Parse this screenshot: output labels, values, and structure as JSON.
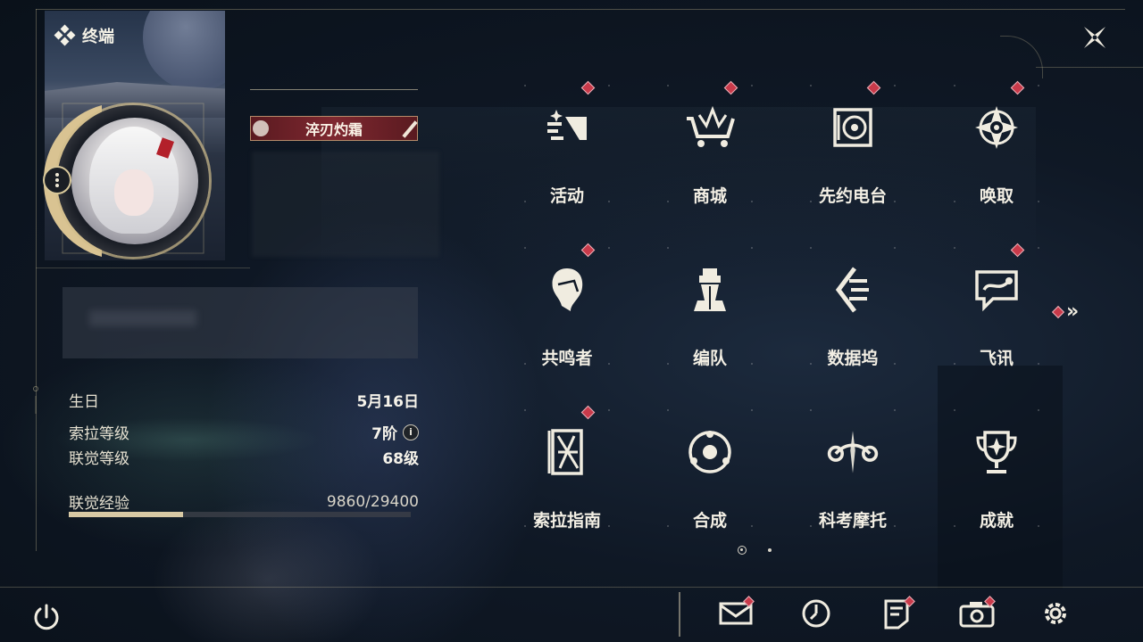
{
  "header": {
    "terminal_label": "终端"
  },
  "profile": {
    "title_badge": "淬刃灼霜",
    "stats": [
      {
        "label": "生日",
        "value": "5月16日"
      },
      {
        "label": "索拉等级",
        "value": "7阶"
      },
      {
        "label": "联觉等级",
        "value": "68级"
      }
    ],
    "experience": {
      "label": "联觉经验",
      "value": "9860/29400",
      "current": 9860,
      "max": 29400
    }
  },
  "menu": {
    "items": [
      {
        "label": "活动",
        "icon": "activity-icon",
        "badge": true
      },
      {
        "label": "商城",
        "icon": "shop-cart-icon",
        "badge": true
      },
      {
        "label": "先约电台",
        "icon": "radio-icon",
        "badge": true
      },
      {
        "label": "唤取",
        "icon": "summon-compass-icon",
        "badge": true
      },
      {
        "label": "共鸣者",
        "icon": "resonator-icon",
        "badge": true
      },
      {
        "label": "编队",
        "icon": "team-chess-icon",
        "badge": false
      },
      {
        "label": "数据坞",
        "icon": "data-bank-icon",
        "badge": false
      },
      {
        "label": "飞讯",
        "icon": "chat-icon",
        "badge": true
      },
      {
        "label": "索拉指南",
        "icon": "guidebook-icon",
        "badge": true
      },
      {
        "label": "合成",
        "icon": "synthesis-icon",
        "badge": false
      },
      {
        "label": "科考摩托",
        "icon": "motorcycle-icon",
        "badge": false
      },
      {
        "label": "成就",
        "icon": "trophy-icon",
        "badge": false
      }
    ],
    "pager": {
      "current": 1,
      "total": 2
    }
  },
  "bottom_bar": {
    "buttons": [
      {
        "icon": "mail-icon",
        "badge": true
      },
      {
        "icon": "clock-icon",
        "badge": false
      },
      {
        "icon": "notice-icon",
        "badge": true
      },
      {
        "icon": "camera-icon",
        "badge": true
      },
      {
        "icon": "settings-gear-icon",
        "badge": false
      }
    ]
  },
  "colors": {
    "accent_gold": "#d8c9a4",
    "badge_red": "#c93a4a",
    "title_badge_bg": "#7e2830"
  }
}
